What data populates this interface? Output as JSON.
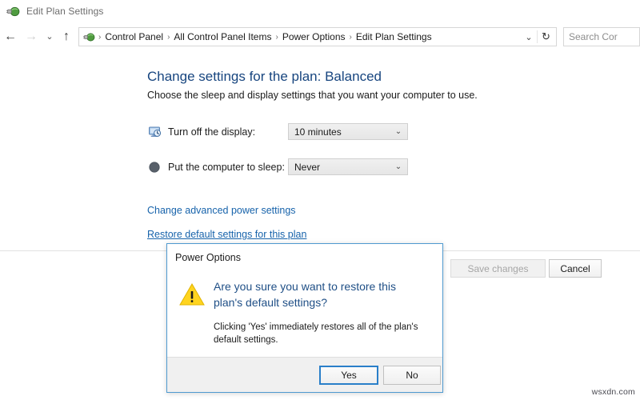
{
  "window": {
    "title": "Edit Plan Settings",
    "icon": "power-plug-icon"
  },
  "navbar": {
    "back_glyph": "←",
    "forward_glyph": "→",
    "history_glyph": "⌄",
    "up_glyph": "↑",
    "breadcrumbs": [
      "Control Panel",
      "All Control Panel Items",
      "Power Options",
      "Edit Plan Settings"
    ],
    "separator": "›",
    "dropdown_glyph": "⌄",
    "refresh_glyph": "↻",
    "search_placeholder": "Search Cor"
  },
  "main": {
    "heading": "Change settings for the plan: Balanced",
    "subheading": "Choose the sleep and display settings that you want your computer to use.",
    "settings": [
      {
        "icon": "display-clock-icon",
        "label": "Turn off the display:",
        "value": "10 minutes",
        "arrow": "⌄"
      },
      {
        "icon": "sleep-moon-icon",
        "label": "Put the computer to sleep:",
        "value": "Never",
        "arrow": "⌄"
      }
    ],
    "links": [
      "Change advanced power settings",
      "Restore default settings for this plan"
    ]
  },
  "commandbar": {
    "save_label": "Save changes",
    "save_disabled": true,
    "cancel_label": "Cancel"
  },
  "dialog": {
    "title": "Power Options",
    "icon": "warning-triangle-icon",
    "main_text": "Are you sure you want to restore this plan's default settings?",
    "detail_text": "Clicking 'Yes' immediately restores all of the plan's default settings.",
    "yes_label": "Yes",
    "no_label": "No"
  },
  "watermark": "wsxdn.com",
  "colors": {
    "heading_blue": "#17457f",
    "link_blue": "#1763ab",
    "dialog_border": "#4f9ad0",
    "dialog_text_blue": "#1f4f86",
    "warning_yellow": "#ffd41f",
    "focus_blue": "#2a7fc9",
    "disabled_text": "#a6a6a6"
  }
}
